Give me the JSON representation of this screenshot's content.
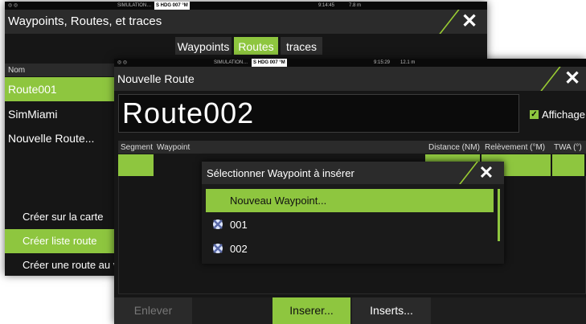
{
  "back_window": {
    "status": {
      "sim": "SIMULATION…",
      "hdg": "S HDG 007 °M",
      "time": "9:14:45",
      "dist": "7.8 m"
    },
    "title": "Waypoints, Routes, et traces",
    "tabs": [
      "Waypoints",
      "Routes",
      "traces"
    ],
    "active_tab": "Routes",
    "list_header": "Nom",
    "routes": [
      "Route001",
      "SimMiami",
      "Nouvelle Route..."
    ],
    "menu": [
      "Créer sur la carte",
      "Créer liste route",
      "Créer une route au v"
    ]
  },
  "front_window": {
    "status": {
      "sim": "SIMULATION…",
      "hdg": "S HDG 007 °M",
      "time": "9:15:29",
      "dist": "12.1 m"
    },
    "title": "Nouvelle Route",
    "route_name": "Route002",
    "display_label": "Affichage",
    "columns": [
      "Segment",
      "Waypoint",
      "Distance (NM)",
      "Relèvement (°M)",
      "TWA (°)"
    ],
    "buttons": [
      "Enlever",
      "Inserer...",
      "Inserts..."
    ]
  },
  "dialog": {
    "title": "Sélectionner Waypoint à insérer",
    "items": [
      "Nouveau Waypoint...",
      "001",
      "002"
    ]
  },
  "colors": {
    "accent": "#8ec63f",
    "panel": "#161616",
    "titlebar": "#2b2b2b"
  },
  "icons": {
    "close": "close-icon",
    "waypoint": "waypoint-icon",
    "check": "checkmark-icon"
  }
}
